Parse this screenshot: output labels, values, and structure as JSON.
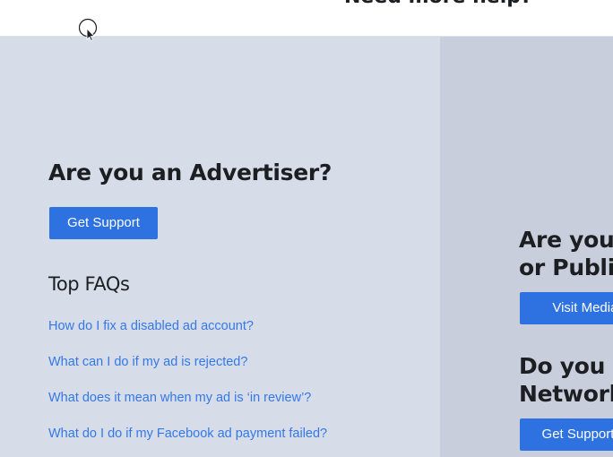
{
  "header": {
    "title": "Need more help?"
  },
  "advertiser": {
    "heading": "Are you an Advertiser?",
    "button_label": "Get Support",
    "faq_title": "Top FAQs",
    "faqs": [
      "How do I fix a disabled ad account?",
      "What can I do if my ad is rejected?",
      "What does it mean when my ad is ‘in review’?",
      "What do I do if my Facebook ad payment failed?"
    ]
  },
  "publisher": {
    "heading_line1": "Are you",
    "heading_line2": "or Publi",
    "button_label": "Visit Media S"
  },
  "audience_network": {
    "heading_line1": "Do you u",
    "heading_line2": "Network",
    "button_label": "Get Support"
  },
  "colors": {
    "primary_button": "#2d72e0",
    "link": "#3578e5",
    "left_panel_bg": "#d6dde9",
    "right_panel_bg": "#c9cedd"
  },
  "icons": {
    "cursor": "mouse-pointer-icon"
  }
}
